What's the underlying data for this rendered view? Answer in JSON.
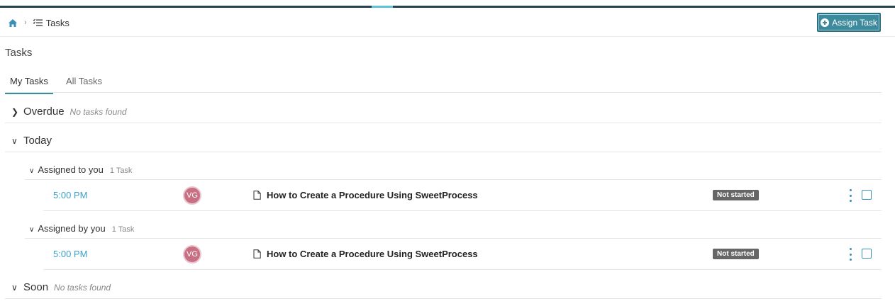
{
  "breadcrumb": {
    "home_icon": "home-icon",
    "current_icon": "list-check-icon",
    "current": "Tasks"
  },
  "header": {
    "assign_button": "Assign Task",
    "assign_icon": "plus-circle-icon"
  },
  "page_title": "Tasks",
  "tabs": [
    {
      "label": "My Tasks",
      "active": true
    },
    {
      "label": "All Tasks",
      "active": false
    }
  ],
  "sections": {
    "overdue": {
      "name": "Overdue",
      "empty": "No tasks found",
      "expanded": false
    },
    "today": {
      "name": "Today",
      "expanded": true,
      "assigned_to_you": {
        "name": "Assigned to you",
        "count": "1 Task",
        "tasks": [
          {
            "time": "5:00 PM",
            "initials": "VG",
            "title": "How to Create a Procedure Using SweetProcess",
            "status": "Not started"
          }
        ]
      },
      "assigned_by_you": {
        "name": "Assigned by you",
        "count": "1 Task",
        "tasks": [
          {
            "time": "5:00 PM",
            "initials": "VG",
            "title": "How to Create a Procedure Using SweetProcess",
            "status": "Not started"
          }
        ]
      }
    },
    "soon": {
      "name": "Soon",
      "empty": "No tasks found",
      "expanded": true
    }
  },
  "colors": {
    "accent": "#3c8a9b",
    "link": "#3ba0c9",
    "avatar": "#c86f83",
    "badge": "#666666"
  }
}
